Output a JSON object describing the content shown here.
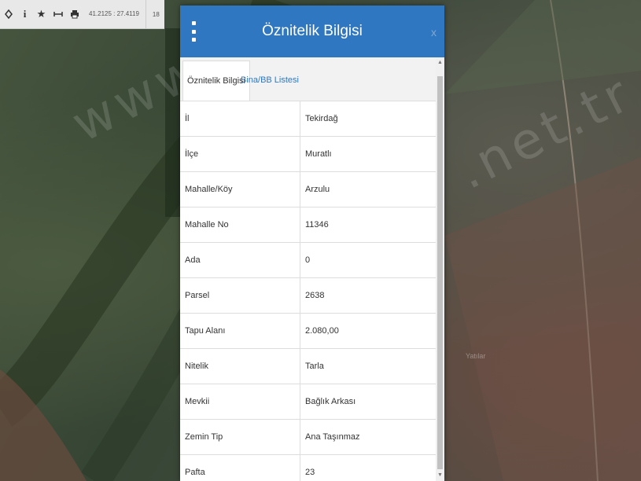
{
  "toolbar": {
    "coordinates": "41.2125 : 27.4119",
    "zoom": "18",
    "icons": [
      "locate-icon",
      "info-icon",
      "star-icon",
      "measure-icon",
      "print-icon"
    ]
  },
  "map": {
    "watermark": "www.",
    "watermark2": ".net.tr",
    "label": "Yatılar"
  },
  "dialog": {
    "title": "Öznitelik Bilgisi",
    "close": "x",
    "tabs": [
      {
        "label": "Öznitelik Bilgisi",
        "active": true
      },
      {
        "label": "Bina/BB Listesi",
        "active": false
      }
    ],
    "rows": [
      {
        "key": "İl",
        "value": "Tekirdağ"
      },
      {
        "key": "İlçe",
        "value": "Muratlı"
      },
      {
        "key": "Mahalle/Köy",
        "value": "Arzulu"
      },
      {
        "key": "Mahalle No",
        "value": "11346"
      },
      {
        "key": "Ada",
        "value": "0"
      },
      {
        "key": "Parsel",
        "value": "2638"
      },
      {
        "key": "Tapu Alanı",
        "value": "2.080,00"
      },
      {
        "key": "Nitelik",
        "value": "Tarla"
      },
      {
        "key": "Mevkii",
        "value": "Bağlık Arkası"
      },
      {
        "key": "Zemin Tip",
        "value": "Ana Taşınmaz"
      },
      {
        "key": "Pafta",
        "value": "23"
      }
    ]
  },
  "colors": {
    "header": "#2f77c0",
    "tab_link": "#2f77c0"
  }
}
